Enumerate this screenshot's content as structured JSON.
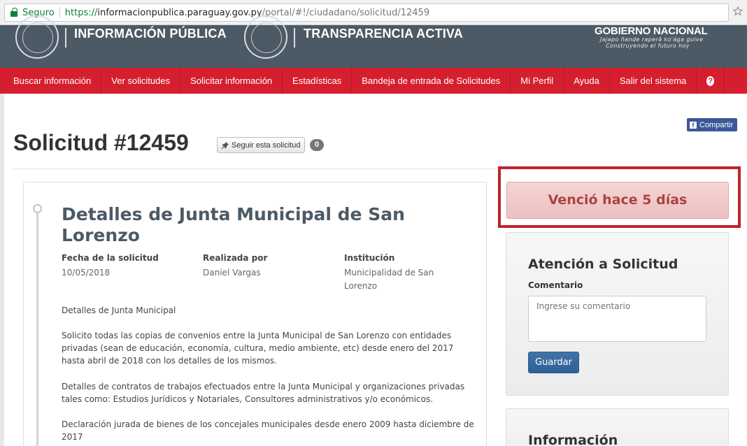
{
  "browser": {
    "secure_label": "Seguro",
    "url_scheme": "https://",
    "url_host": "informacionpublica.paraguay.gov.py",
    "url_path": "/portal/#!/ciudadano/solicitud/12459"
  },
  "header": {
    "brand_left": "INFORMACIÓN PÚBLICA",
    "brand_right": "TRANSPARENCIA ACTIVA",
    "gov_name": "GOBIERNO NACIONAL",
    "gov_sub1": "Jajapo ñande raperã ko'ága guive",
    "gov_sub2": "Construyendo el futuro hoy"
  },
  "nav": {
    "items": [
      "Buscar información",
      "Ver solicitudes",
      "Solicitar información",
      "Estadísticas",
      "Bandeja de entrada de Solicitudes",
      "Mi Perfil",
      "Ayuda",
      "Salir del sistema"
    ],
    "help": "?"
  },
  "share_label": "Compartir",
  "request": {
    "title": "Solicitud #12459",
    "follow_label": "Seguir esta solicitud",
    "followers": "0"
  },
  "details": {
    "title": "Detalles de Junta Municipal de San Lorenzo",
    "date_label": "Fecha de la solicitud",
    "date_value": "10/05/2018",
    "by_label": "Realizada por",
    "by_value": "Daniel Vargas",
    "institution_label": "Institución",
    "institution_value": "Municipalidad de San Lorenzo",
    "paragraphs": [
      "Detalles de Junta Municipal",
      "Solicito todas las copias de convenios entre la Junta Municipal de San Lorenzo con entidades privadas (sean de educación, economía, cultura, medio ambiente, etc) desde enero del 2017 hasta abril de 2018 con los detalles de los mismos.",
      "Detalles de contratos de trabajos efectuados entre la Junta Municipal y organizaciones privadas tales como: Estudios Jurídicos y Notariales, Consultores administrativos y/o económicos.",
      "Declaración jurada de bienes de los concejales municipales desde enero 2009 hasta diciembre de 2017"
    ]
  },
  "status": {
    "expired": "Venció hace 5 días"
  },
  "attention": {
    "title": "Atención a Solicitud",
    "comment_label": "Comentario",
    "comment_placeholder": "Ingrese su comentario",
    "save_label": "Guardar"
  },
  "info_panel": {
    "title": "Información"
  },
  "colors": {
    "nav_red": "#d61f2e",
    "header_slate": "#4c5a66",
    "primary_blue": "#2f6198",
    "alert_red": "#a94442",
    "facebook": "#3b5998"
  }
}
